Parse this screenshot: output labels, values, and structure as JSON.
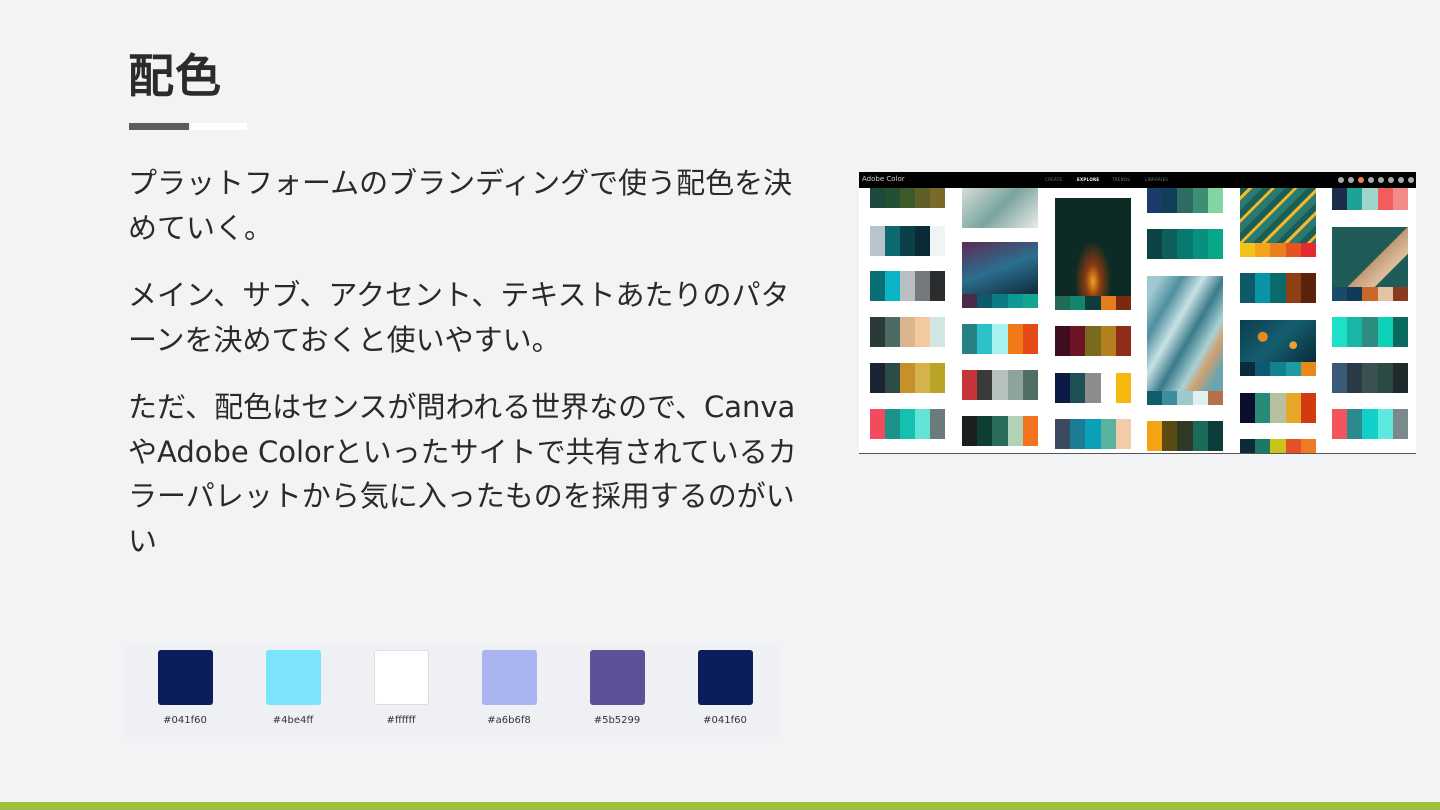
{
  "title": "配色",
  "paragraphs": [
    "プラットフォームのブランディングで使う配色を決めていく。",
    "メイン、サブ、アクセント、テキストあたりのパターンを決めておくと使いやすい。",
    "ただ、配色はセンスが問われる世界なので、CanvaやAdobe Colorといったサイトで共有されているカラーパレットから気に入ったものを採用するのがいい"
  ],
  "palette": [
    {
      "hex": "#041f60",
      "color": "#0b1d5c"
    },
    {
      "hex": "#4be4ff",
      "color": "#7be3fb"
    },
    {
      "hex": "#ffffff",
      "color": "#ffffff"
    },
    {
      "hex": "#a6b6f8",
      "color": "#a9b4f0"
    },
    {
      "hex": "#5b5299",
      "color": "#5b5297"
    },
    {
      "hex": "#041f60",
      "color": "#0b1d5c"
    }
  ],
  "screenshot": {
    "app_name": "Adobe Color",
    "nav": [
      "CREATE",
      "EXPLORE",
      "TRENDS",
      "LIBRARIES"
    ],
    "active_nav": "EXPLORE"
  },
  "colors": {
    "background": "#f2f3f4",
    "accent_bar": "#9bc138",
    "title_underline": "#5b5b5b"
  }
}
